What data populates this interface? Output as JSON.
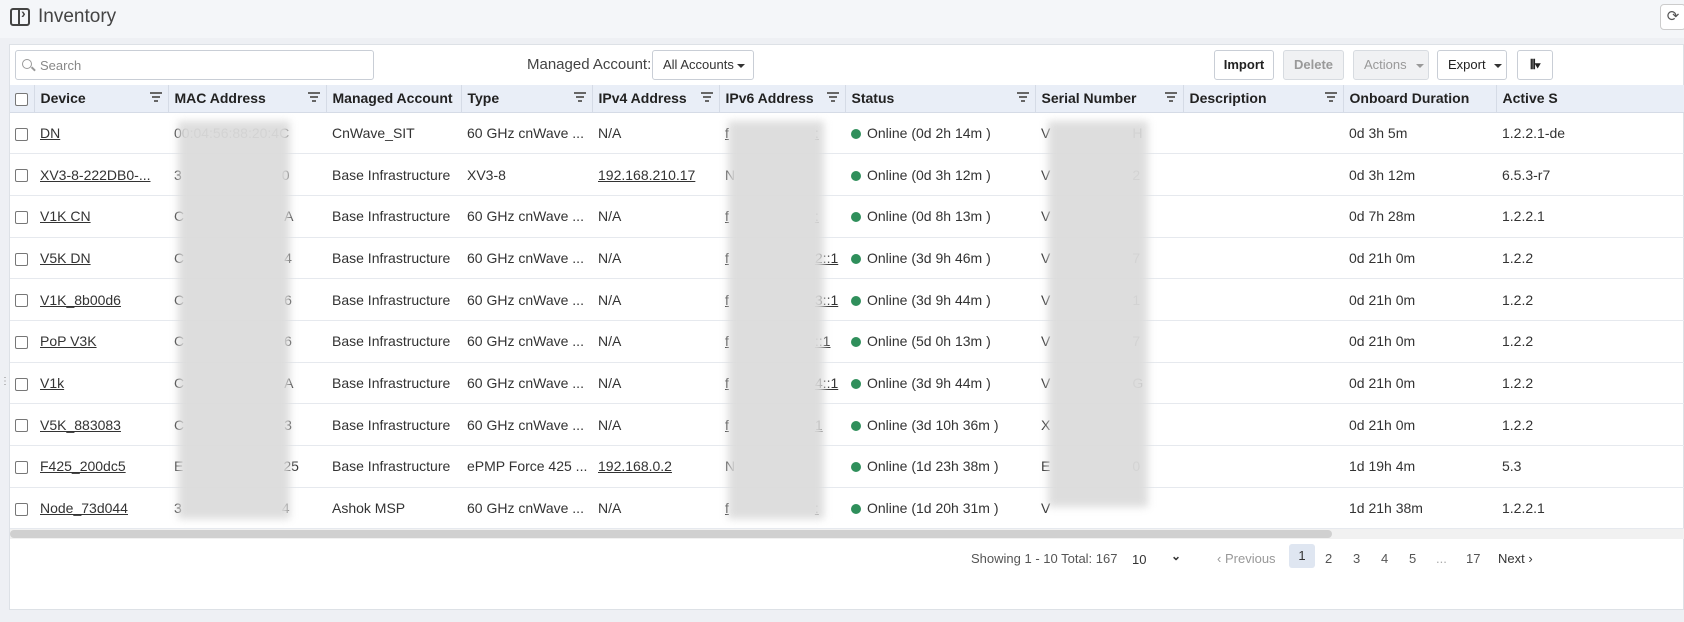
{
  "header": {
    "title": "Inventory"
  },
  "toolbar": {
    "search_placeholder": "Search",
    "managed_account_label": "Managed Account:",
    "managed_account_value": "All Accounts",
    "import_label": "Import",
    "delete_label": "Delete",
    "actions_label": "Actions",
    "export_label": "Export"
  },
  "table": {
    "columns": [
      "Device",
      "MAC Address",
      "Managed Account",
      "Type",
      "IPv4 Address",
      "IPv6 Address",
      "Status",
      "Serial Number",
      "Description",
      "Onboard Duration",
      "Active S"
    ],
    "rows": [
      {
        "device": "DN",
        "mac": "00:04:56:88:20:4C",
        "account": "CnWave_SIT",
        "type": "60 GHz cnWave ...",
        "ipv4": "N/A",
        "ipv6": "f",
        "ipv6_suffix": ":",
        "status": "Online (0d 2h 14m )",
        "serial": "V",
        "serial_suffix": "H",
        "description": "",
        "onboard": "0d 3h 5m",
        "active": "1.2.2.1-de"
      },
      {
        "device": "XV3-8-222DB0-...",
        "mac": "3",
        "mac_suffix": "0",
        "account": "Base Infrastructure",
        "type": "XV3-8",
        "ipv4": "192.168.210.17",
        "ipv6": "N",
        "ipv6_suffix": "",
        "status": "Online (0d 3h 12m )",
        "serial": "V",
        "serial_suffix": "2",
        "description": "",
        "onboard": "0d 3h 12m",
        "active": "6.5.3-r7"
      },
      {
        "device": "V1K CN",
        "mac": "C",
        "mac_suffix": "A",
        "account": "Base Infrastructure",
        "type": "60 GHz cnWave ...",
        "ipv4": "N/A",
        "ipv6": "f",
        "ipv6_suffix": ":",
        "status": "Online (0d 8h 13m )",
        "serial": "V",
        "serial_suffix": "",
        "description": "",
        "onboard": "0d 7h 28m",
        "active": "1.2.2.1"
      },
      {
        "device": "V5K DN",
        "mac": "C",
        "mac_suffix": "4",
        "account": "Base Infrastructure",
        "type": "60 GHz cnWave ...",
        "ipv4": "N/A",
        "ipv6": "f",
        "ipv6_suffix": "2::1",
        "status": "Online (3d 9h 46m )",
        "serial": "V",
        "serial_suffix": "7",
        "description": "",
        "onboard": "0d 21h 0m",
        "active": "1.2.2"
      },
      {
        "device": "V1K_8b00d6",
        "mac": "C",
        "mac_suffix": "6",
        "account": "Base Infrastructure",
        "type": "60 GHz cnWave ...",
        "ipv4": "N/A",
        "ipv6": "f",
        "ipv6_suffix": "3::1",
        "status": "Online (3d 9h 44m )",
        "serial": "V",
        "serial_suffix": "1",
        "description": "",
        "onboard": "0d 21h 0m",
        "active": "1.2.2"
      },
      {
        "device": "PoP V3K",
        "mac": "C",
        "mac_suffix": "6",
        "account": "Base Infrastructure",
        "type": "60 GHz cnWave ...",
        "ipv4": "N/A",
        "ipv6": "f",
        "ipv6_suffix": "::1",
        "status": "Online (5d 0h 13m )",
        "serial": "V",
        "serial_suffix": "7",
        "description": "",
        "onboard": "0d 21h 0m",
        "active": "1.2.2"
      },
      {
        "device": "V1k",
        "mac": "C",
        "mac_suffix": "A",
        "account": "Base Infrastructure",
        "type": "60 GHz cnWave ...",
        "ipv4": "N/A",
        "ipv6": "f",
        "ipv6_suffix": "4::1",
        "status": "Online (3d 9h 44m )",
        "serial": "V",
        "serial_suffix": "G",
        "description": "",
        "onboard": "0d 21h 0m",
        "active": "1.2.2"
      },
      {
        "device": "V5K_883083",
        "mac": "C",
        "mac_suffix": "3",
        "account": "Base Infrastructure",
        "type": "60 GHz cnWave ...",
        "ipv4": "N/A",
        "ipv6": "f",
        "ipv6_suffix": "1",
        "status": "Online (3d 10h 36m )",
        "serial": "X",
        "serial_suffix": "",
        "description": "",
        "onboard": "0d 21h 0m",
        "active": "1.2.2"
      },
      {
        "device": "F425_200dc5",
        "mac": "E",
        "mac_suffix": "25",
        "account": "Base Infrastructure",
        "type": "ePMP Force 425 ...",
        "ipv4": "192.168.0.2",
        "ipv6": "N",
        "ipv6_suffix": "",
        "status": "Online (1d 23h 38m )",
        "serial": "E",
        "serial_suffix": "0",
        "description": "",
        "onboard": "1d 19h 4m",
        "active": "5.3"
      },
      {
        "device": "Node_73d044",
        "mac": "3",
        "mac_suffix": "4",
        "account": "Ashok MSP",
        "type": "60 GHz cnWave ...",
        "ipv4": "N/A",
        "ipv6": "f",
        "ipv6_suffix": ":",
        "status": "Online (1d 20h 31m )",
        "serial": "V",
        "serial_suffix": "",
        "description": "",
        "onboard": "1d 21h 38m",
        "active": "1.2.2.1"
      }
    ]
  },
  "pagination": {
    "showing": "Showing 1 - 10 Total: 167",
    "page_size": "10",
    "previous": "Previous",
    "pages": [
      "1",
      "2",
      "3",
      "4",
      "5",
      "...",
      "17"
    ],
    "next": "Next"
  },
  "colors": {
    "status_online": "#2f8f5b",
    "header_bg": "#e9eef7",
    "active_page_bg": "#dfe6f1"
  }
}
